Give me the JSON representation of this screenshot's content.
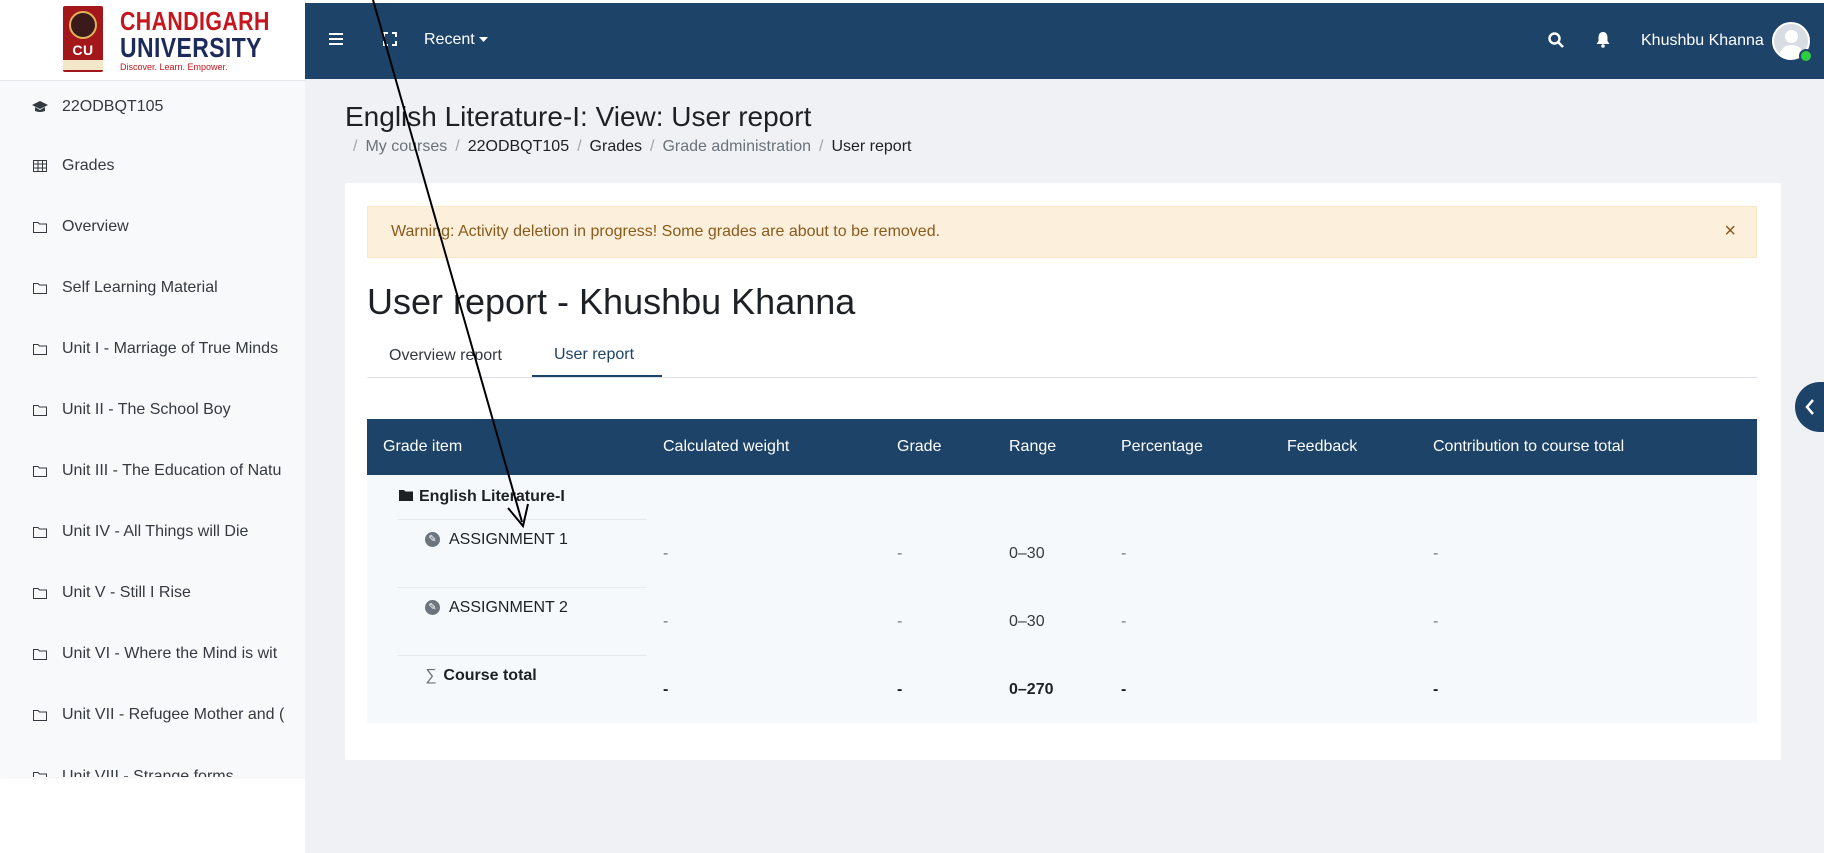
{
  "logo": {
    "line1": "CHANDIGARH",
    "line2": "UNIVERSITY",
    "tagline": "Discover. Learn. Empower.",
    "emblem_text": "CU"
  },
  "sidebar": {
    "items": [
      {
        "label": "22ODBQT105",
        "icon": "graduation-cap-icon"
      },
      {
        "label": "Grades",
        "icon": "table-icon"
      },
      {
        "label": "Overview",
        "icon": "folder-icon"
      },
      {
        "label": "Self Learning Material",
        "icon": "folder-icon"
      },
      {
        "label": "Unit I - Marriage of True Minds",
        "icon": "folder-icon"
      },
      {
        "label": "Unit II - The School Boy",
        "icon": "folder-icon"
      },
      {
        "label": "Unit III - The Education of Natu",
        "icon": "folder-icon"
      },
      {
        "label": "Unit IV - All Things will Die",
        "icon": "folder-icon"
      },
      {
        "label": "Unit V - Still I Rise",
        "icon": "folder-icon"
      },
      {
        "label": "Unit VI - Where the Mind is wit",
        "icon": "folder-icon"
      },
      {
        "label": "Unit VII - Refugee Mother and (",
        "icon": "folder-icon"
      },
      {
        "label": "Unit VIII - Strange forms",
        "icon": "folder-icon"
      }
    ]
  },
  "topbar": {
    "recent_label": "Recent",
    "user_name": "Khushbu Khanna",
    "icons": [
      "hamburger-icon",
      "fullscreen-icon",
      "search-icon",
      "bell-icon"
    ]
  },
  "page": {
    "title": "English Literature-I: View: User report",
    "breadcrumb": [
      "My courses",
      "22ODBQT105",
      "Grades",
      "Grade administration",
      "User report"
    ]
  },
  "warning": {
    "text": "Warning: Activity deletion in progress! Some grades are about to be removed.",
    "close": "×"
  },
  "report": {
    "heading": "User report - Khushbu Khanna",
    "tabs": [
      "Overview report",
      "User report"
    ],
    "active_tab": "User report"
  },
  "table": {
    "headers": [
      "Grade item",
      "Calculated weight",
      "Grade",
      "Range",
      "Percentage",
      "Feedback",
      "Contribution to course total"
    ],
    "category": "English Literature-I",
    "rows": [
      {
        "item": "ASSIGNMENT 1",
        "weight": "-",
        "grade": "-",
        "range": "0–30",
        "percentage": "-",
        "feedback": "",
        "contribution": "-"
      },
      {
        "item": "ASSIGNMENT 2",
        "weight": "-",
        "grade": "-",
        "range": "0–30",
        "percentage": "-",
        "feedback": "",
        "contribution": "-"
      }
    ],
    "total": {
      "item": "Course total",
      "symbol": "∑",
      "weight": "-",
      "grade": "-",
      "range": "0–270",
      "percentage": "-",
      "feedback": "",
      "contribution": "-"
    }
  },
  "colors": {
    "navbar": "#1d4368",
    "warning_bg": "#fcefdc",
    "warning_text": "#8a5a1a",
    "brand_red": "#c4161c"
  }
}
